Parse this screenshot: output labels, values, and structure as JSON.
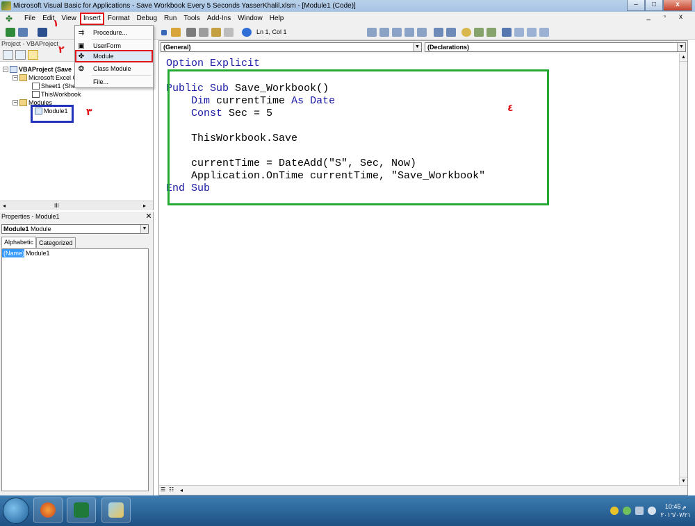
{
  "window": {
    "title": "Microsoft Visual Basic for Applications - Save Workbook Every 5 Seconds YasserKhalil.xlsm - [Module1 (Code)]",
    "min": "–",
    "max": "□",
    "close": "x"
  },
  "menubar": {
    "items": [
      "File",
      "Edit",
      "View",
      "Insert",
      "Format",
      "Debug",
      "Run",
      "Tools",
      "Add-Ins",
      "Window",
      "Help"
    ],
    "right": "_ ▫ x"
  },
  "toolbar": {
    "status": "Ln 1, Col 1"
  },
  "insert_menu": {
    "items": [
      {
        "icon": "procedure-icon",
        "label": "Procedure..."
      },
      {
        "icon": "userform-icon",
        "label": "UserForm"
      },
      {
        "icon": "module-icon",
        "label": "Module"
      },
      {
        "icon": "class-module-icon",
        "label": "Class Module"
      },
      {
        "icon": "file-icon",
        "label": "File..."
      }
    ]
  },
  "project": {
    "caption": "Project - VBAProject",
    "tree": {
      "root": "VBAProject (Save",
      "excel_objects": "Microsoft Excel O",
      "sheet1": "Sheet1 (She",
      "thisworkbook": "ThisWorkbook",
      "modules": "Modules",
      "module1": "Module1"
    },
    "scroll_mark": "III"
  },
  "properties": {
    "caption": "Properties - Module1",
    "combo": {
      "name": "Module1",
      "type": "Module"
    },
    "tabs": [
      "Alphabetic",
      "Categorized"
    ],
    "rows": [
      {
        "name": "(Name)",
        "value": "Module1"
      }
    ]
  },
  "code": {
    "object_combo": "(General)",
    "proc_combo": "(Declarations)",
    "lines": [
      [
        "Option Explicit"
      ],
      [
        ""
      ],
      [
        "Public Sub Save_Workbook()"
      ],
      [
        "    Dim currentTime As Date"
      ],
      [
        "    Const Sec = 5"
      ],
      [
        ""
      ],
      [
        "    ThisWorkbook.Save"
      ],
      [
        ""
      ],
      [
        "    currentTime = DateAdd(\"S\", Sec, Now)"
      ],
      [
        "    Application.OnTime currentTime, \"Save_Workbook\""
      ],
      [
        "End Sub"
      ]
    ]
  },
  "annotations": {
    "n1": "١",
    "n2": "٢",
    "n3": "٣",
    "n4": "٤"
  },
  "taskbar": {
    "time": "10:45 م",
    "date": "٢٠١٦/٠٧/٢١"
  },
  "colors": {
    "keyword": "#1a1aa6",
    "highlight_red": "#e0151b",
    "green_box": "#22aa33",
    "blue_box": "#2233bb"
  }
}
